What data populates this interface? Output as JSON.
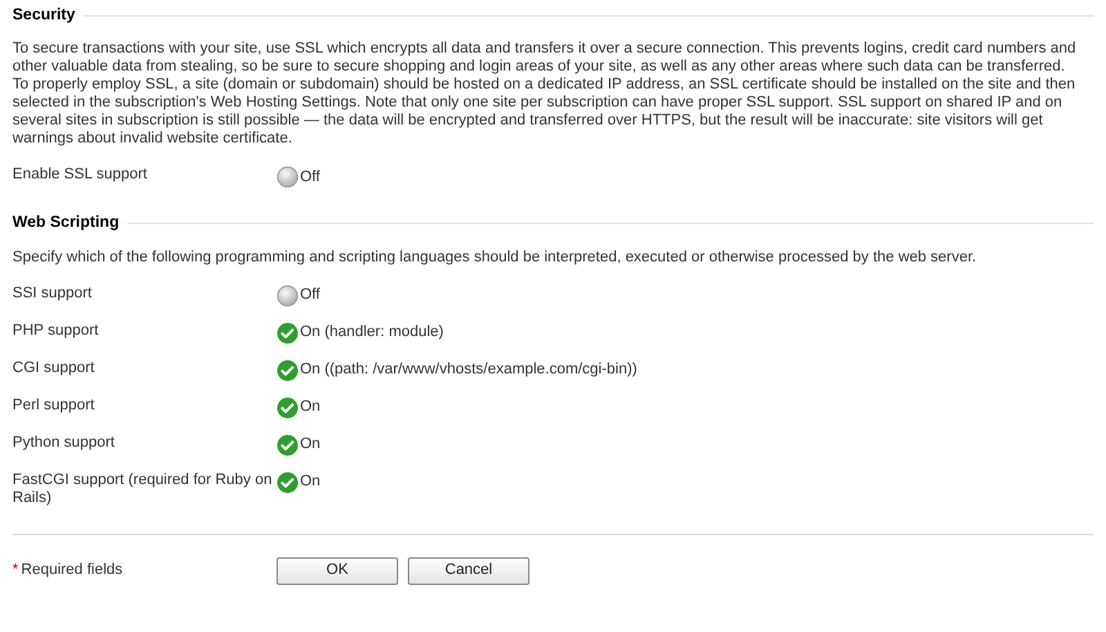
{
  "sections": [
    {
      "title": "Security",
      "description": "To secure transactions with your site, use SSL which encrypts all data and transfers it over a secure connection. This prevents logins, credit card numbers and other valuable data from stealing, so be sure to secure shopping and login areas of your site, as well as any other areas where such data can be transferred. To properly employ SSL, a site (domain or subdomain) should be hosted on a dedicated IP address, an SSL certificate should be installed on the site and then selected in the subscription's Web Hosting Settings. Note that only one site per subscription can have proper SSL support. SSL support on shared IP and on several sites in subscription is still possible — the data will be encrypted and transferred over HTTPS, but the result will be inaccurate: site visitors will get warnings about invalid website certificate.",
      "settings": [
        {
          "label": "Enable SSL support",
          "on": false,
          "value": "Off"
        }
      ]
    },
    {
      "title": "Web Scripting",
      "description": "Specify which of the following programming and scripting languages should be interpreted, executed or otherwise processed by the web server.",
      "settings": [
        {
          "label": "SSI support",
          "on": false,
          "value": "Off"
        },
        {
          "label": "PHP support",
          "on": true,
          "value": "On (handler: module)"
        },
        {
          "label": "CGI support",
          "on": true,
          "value": "On ((path: /var/www/vhosts/example.com/cgi-bin))"
        },
        {
          "label": "Perl support",
          "on": true,
          "value": "On"
        },
        {
          "label": "Python support",
          "on": true,
          "value": "On"
        },
        {
          "label": "FastCGI support (required for Ruby on Rails)",
          "on": true,
          "value": "On"
        }
      ]
    }
  ],
  "footer": {
    "required_marker": "*",
    "required_text": "Required fields",
    "buttons": [
      "OK",
      "Cancel"
    ]
  }
}
